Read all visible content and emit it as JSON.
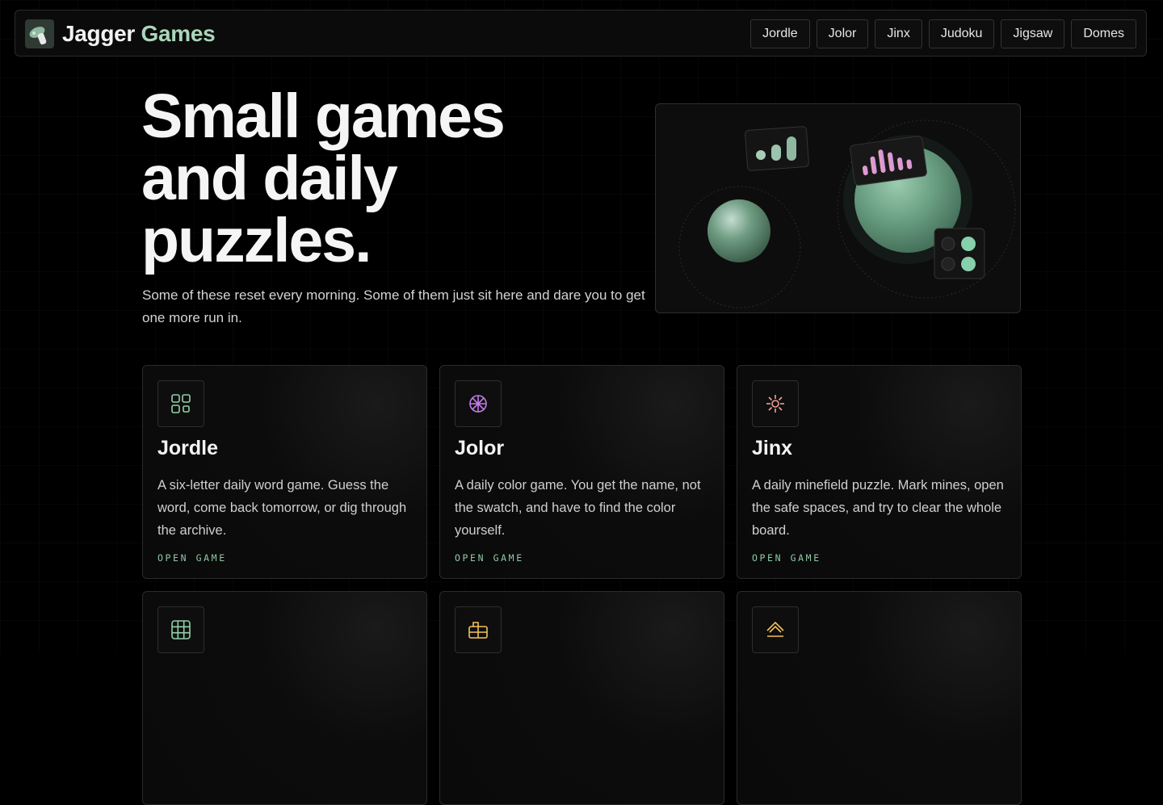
{
  "brand": {
    "name_part1": "Jagger",
    "name_part2": "Games",
    "logo_icon": "mushroom-logo-icon"
  },
  "nav": {
    "links": [
      "Jordle",
      "Jolor",
      "Jinx",
      "Judoku",
      "Jigsaw",
      "Domes"
    ]
  },
  "hero": {
    "title_line1": "Small games",
    "title_line2": "and daily",
    "title_line3": "puzzles.",
    "subtitle": "Some of these reset every morning. Some of them just sit here and dare you to get one more run in."
  },
  "cards": [
    {
      "title": "Jordle",
      "description": "A six-letter daily word game. Guess the word, come back tomorrow, or dig through the archive.",
      "cta": "OPEN GAME",
      "icon": "grid-2x2-icon",
      "icon_color": "#8fd1a8"
    },
    {
      "title": "Jolor",
      "description": "A daily color game. You get the name, not the swatch, and have to find the color yourself.",
      "cta": "OPEN GAME",
      "icon": "color-wheel-icon",
      "icon_color": "#c27be8"
    },
    {
      "title": "Jinx",
      "description": "A daily minefield puzzle. Mark mines, open the safe spaces, and try to clear the whole board.",
      "cta": "OPEN GAME",
      "icon": "sparkle-icon",
      "icon_color": "#f0a09a"
    },
    {
      "title": "",
      "description": "",
      "cta": "",
      "icon": "sudoku-grid-icon",
      "icon_color": "#8fd1a8"
    },
    {
      "title": "",
      "description": "",
      "cta": "",
      "icon": "puzzle-box-icon",
      "icon_color": "#f2c05a"
    },
    {
      "title": "",
      "description": "",
      "cta": "",
      "icon": "dome-icon",
      "icon_color": "#f2c05a"
    }
  ],
  "colors": {
    "accent_green": "#a9d6b9",
    "cta_green": "#8fc9a4",
    "background": "#000000"
  }
}
